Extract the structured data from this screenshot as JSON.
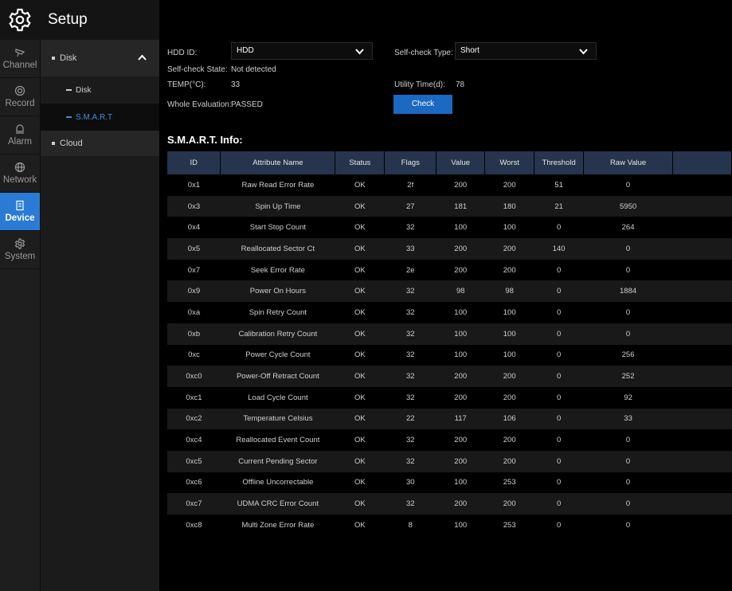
{
  "header": {
    "title": "Setup"
  },
  "rail": [
    {
      "label": "Channel",
      "icon": "camera-icon"
    },
    {
      "label": "Record",
      "icon": "record-icon"
    },
    {
      "label": "Alarm",
      "icon": "bell-icon"
    },
    {
      "label": "Network",
      "icon": "globe-icon"
    },
    {
      "label": "Device",
      "icon": "device-icon",
      "active": true
    },
    {
      "label": "System",
      "icon": "gear-icon"
    }
  ],
  "submenu": {
    "disk_group": "Disk",
    "disk_child": "Disk",
    "smart_child": "S.M.A.R.T",
    "cloud_group": "Cloud"
  },
  "form": {
    "hdd_id_label": "HDD ID:",
    "hdd_id_value": "HDD",
    "self_check_type_label": "Self-check Type:",
    "self_check_type_value": "Short",
    "self_check_state_label": "Self-check State:",
    "self_check_state_value": "Not detected",
    "temp_label": "TEMP(°C):",
    "temp_value": "33",
    "utility_label": "Utility Time(d):",
    "utility_value": "78",
    "whole_eval_label": "Whole Evaluation:",
    "whole_eval_value": "PASSED",
    "check_button": "Check"
  },
  "smart": {
    "title": "S.M.A.R.T. Info:",
    "columns": [
      "ID",
      "Attribute Name",
      "Status",
      "Flags",
      "Value",
      "Worst",
      "Threshold",
      "Raw Value",
      ""
    ],
    "rows": [
      [
        "0x1",
        "Raw Read Error Rate",
        "OK",
        "2f",
        "200",
        "200",
        "51",
        "0"
      ],
      [
        "0x3",
        "Spin Up Time",
        "OK",
        "27",
        "181",
        "180",
        "21",
        "5950"
      ],
      [
        "0x4",
        "Start Stop Count",
        "OK",
        "32",
        "100",
        "100",
        "0",
        "264"
      ],
      [
        "0x5",
        "Reallocated Sector Ct",
        "OK",
        "33",
        "200",
        "200",
        "140",
        "0"
      ],
      [
        "0x7",
        "Seek Error Rate",
        "OK",
        "2e",
        "200",
        "200",
        "0",
        "0"
      ],
      [
        "0x9",
        "Power On Hours",
        "OK",
        "32",
        "98",
        "98",
        "0",
        "1884"
      ],
      [
        "0xa",
        "Spin Retry Count",
        "OK",
        "32",
        "100",
        "100",
        "0",
        "0"
      ],
      [
        "0xb",
        "Calibration Retry Count",
        "OK",
        "32",
        "100",
        "100",
        "0",
        "0"
      ],
      [
        "0xc",
        "Power Cycle Count",
        "OK",
        "32",
        "100",
        "100",
        "0",
        "256"
      ],
      [
        "0xc0",
        "Power-Off Retract Count",
        "OK",
        "32",
        "200",
        "200",
        "0",
        "252"
      ],
      [
        "0xc1",
        "Load Cycle Count",
        "OK",
        "32",
        "200",
        "200",
        "0",
        "92"
      ],
      [
        "0xc2",
        "Temperature Celsius",
        "OK",
        "22",
        "117",
        "106",
        "0",
        "33"
      ],
      [
        "0xc4",
        "Reallocated Event Count",
        "OK",
        "32",
        "200",
        "200",
        "0",
        "0"
      ],
      [
        "0xc5",
        "Current Pending Sector",
        "OK",
        "32",
        "200",
        "200",
        "0",
        "0"
      ],
      [
        "0xc6",
        "Offline Uncorrectable",
        "OK",
        "30",
        "100",
        "253",
        "0",
        "0"
      ],
      [
        "0xc7",
        "UDMA CRC Error Count",
        "OK",
        "32",
        "200",
        "200",
        "0",
        "0"
      ],
      [
        "0xc8",
        "Multi Zone Error Rate",
        "OK",
        "8",
        "100",
        "253",
        "0",
        "0"
      ]
    ]
  },
  "colors": {
    "accent": "#2a7bd6",
    "header_row": "#24354d",
    "check_button": "#1c69c2"
  }
}
